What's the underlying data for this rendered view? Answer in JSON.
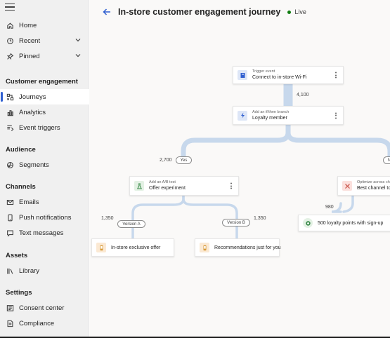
{
  "sidebar": {
    "top_items": [
      {
        "label": "Home",
        "icon": "home-icon"
      },
      {
        "label": "Recent",
        "icon": "clock-icon"
      },
      {
        "label": "Pinned",
        "icon": "pin-icon"
      }
    ],
    "sections": [
      {
        "title": "Customer engagement",
        "items": [
          {
            "label": "Journeys",
            "icon": "journey-icon",
            "selected": true
          },
          {
            "label": "Analytics",
            "icon": "analytics-icon"
          },
          {
            "label": "Event triggers",
            "icon": "event-trigger-icon"
          }
        ]
      },
      {
        "title": "Audience",
        "items": [
          {
            "label": "Segments",
            "icon": "segments-icon"
          }
        ]
      },
      {
        "title": "Channels",
        "items": [
          {
            "label": "Emails",
            "icon": "mail-icon"
          },
          {
            "label": "Push notifications",
            "icon": "phone-icon"
          },
          {
            "label": "Text messages",
            "icon": "chat-icon"
          }
        ]
      },
      {
        "title": "Assets",
        "items": [
          {
            "label": "Library",
            "icon": "library-icon"
          }
        ]
      },
      {
        "title": "Settings",
        "items": [
          {
            "label": "Consent center",
            "icon": "consent-icon"
          },
          {
            "label": "Compliance",
            "icon": "compliance-icon"
          }
        ]
      }
    ]
  },
  "header": {
    "title": "In-store customer engagement journey",
    "status": "Live",
    "status_color": "#107c10"
  },
  "flow": {
    "trigger": {
      "kind": "Trigger event",
      "name": "Connect to in-store Wi-Fi"
    },
    "count_trigger": "4,100",
    "branch": {
      "kind": "Add an if/then branch",
      "name": "Loyalty member"
    },
    "count_yes": "2,700",
    "yes_label": "Yes",
    "right_pill_label": "N",
    "ab_test": {
      "kind": "Add an A/B test",
      "name": "Offer experiment"
    },
    "optimize": {
      "kind": "Optimize across channels",
      "name": "Best channel to c"
    },
    "count_a": "1,350",
    "version_a": "Version A",
    "version_b": "Version B",
    "count_b": "1,350",
    "count_right": "980",
    "loyalty_points": {
      "name": "500 loyalty points with sign-up"
    },
    "offer_a": {
      "name": "In-store exclusive offer"
    },
    "offer_b": {
      "name": "Recommendations just for you"
    }
  },
  "colors": {
    "accent": "#2f5fd0",
    "connector": "#c7d8ec",
    "tile_blue": "#dde6f7",
    "tile_green": "#e3f1e4",
    "tile_orange": "#fbe9d3",
    "tile_red": "#fbe0dd"
  }
}
